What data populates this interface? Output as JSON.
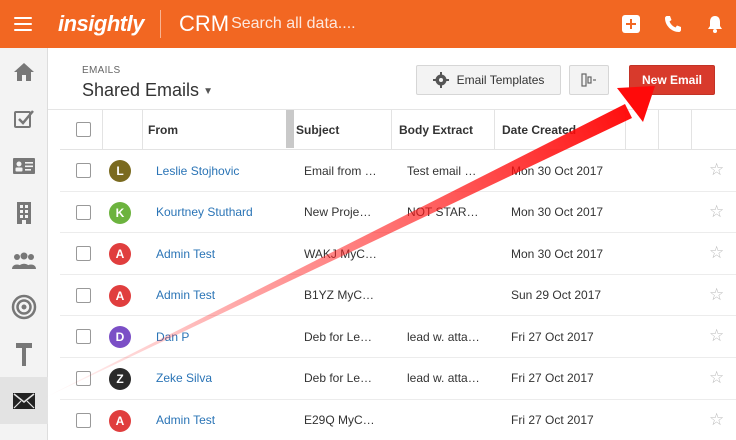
{
  "topbar": {
    "logo": "insightly",
    "app_name": "CRM",
    "search_placeholder": "Search all data...."
  },
  "header": {
    "section_label": "EMAILS",
    "view_title": "Shared Emails",
    "templates_label": "Email Templates",
    "new_email_label": "New Email"
  },
  "table": {
    "columns": {
      "from": "From",
      "subject": "Subject",
      "body": "Body Extract",
      "date": "Date Created"
    },
    "rows": [
      {
        "initial": "L",
        "color": "#7a6a1f",
        "from": "Leslie Stojhovic",
        "subject": "Email from …",
        "body": "Test email …",
        "date": "Mon 30 Oct 2017"
      },
      {
        "initial": "K",
        "color": "#6cb33e",
        "from": "Kourtney Stuthard",
        "subject": "New Proje…",
        "body": "NOT STAR…",
        "date": "Mon 30 Oct 2017"
      },
      {
        "initial": "A",
        "color": "#e03e3e",
        "from": "Admin Test",
        "subject": "WAKJ MyC…",
        "body": "",
        "date": "Mon 30 Oct 2017"
      },
      {
        "initial": "A",
        "color": "#e03e3e",
        "from": "Admin Test",
        "subject": "B1YZ MyC…",
        "body": "",
        "date": "Sun 29 Oct 2017"
      },
      {
        "initial": "D",
        "color": "#7b4fc6",
        "from": "Dan P",
        "subject": "Deb for Le…",
        "body": "lead w. atta…",
        "date": "Fri 27 Oct 2017"
      },
      {
        "initial": "Z",
        "color": "#2b2b2b",
        "from": "Zeke Silva",
        "subject": "Deb for Le…",
        "body": "lead w. atta…",
        "date": "Fri 27 Oct 2017"
      },
      {
        "initial": "A",
        "color": "#e03e3e",
        "from": "Admin Test",
        "subject": "E29Q MyC…",
        "body": "",
        "date": "Fri 27 Oct 2017"
      }
    ]
  },
  "sidebar": {
    "items": [
      "home-icon",
      "tasks-icon",
      "contacts-icon",
      "organizations-icon",
      "leads-icon",
      "opportunities-icon",
      "projects-icon",
      "emails-icon"
    ]
  },
  "colors": {
    "brand": "#f26722",
    "primary_button": "#d83a2c",
    "link": "#2a74b6",
    "annotation_arrow": "#ff1a1a"
  }
}
